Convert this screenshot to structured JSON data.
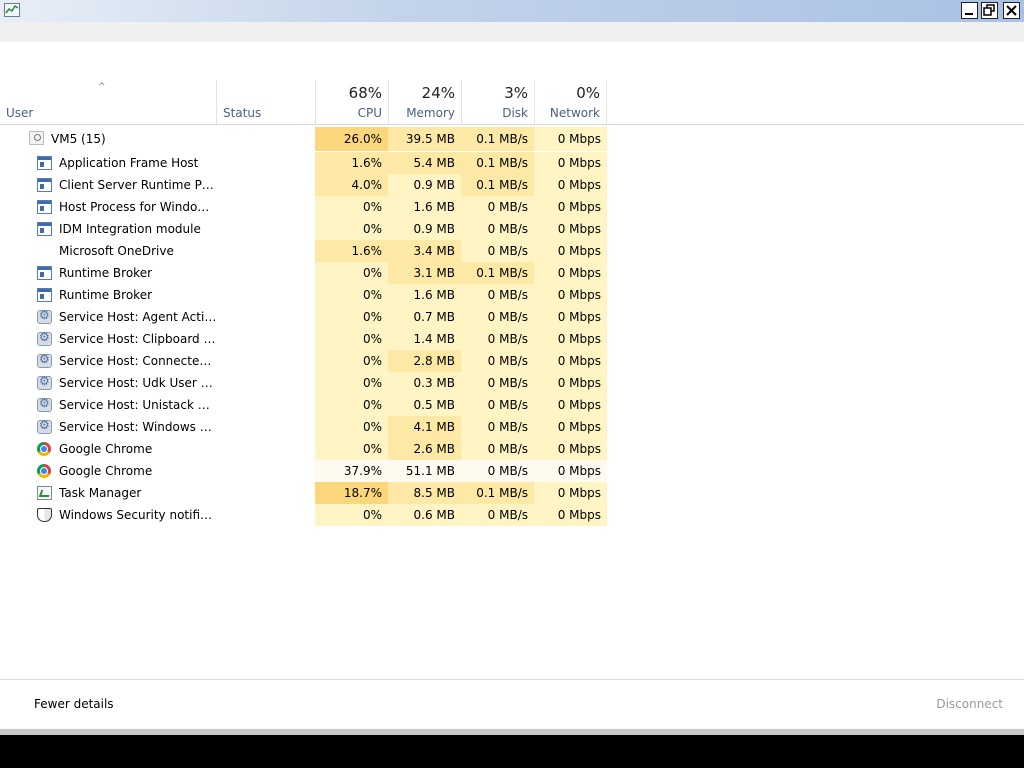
{
  "header": {
    "sort_arrow": "^",
    "user_label": "User",
    "status_label": "Status",
    "cpu_pct": "68%",
    "cpu_label": "CPU",
    "memory_pct": "24%",
    "memory_label": "Memory",
    "disk_pct": "3%",
    "disk_label": "Disk",
    "network_pct": "0%",
    "network_label": "Network"
  },
  "group": {
    "name": "VM5 (15)",
    "cpu": "26.0%",
    "memory": "39.5 MB",
    "disk": "0.1 MB/s",
    "network": "0 Mbps"
  },
  "processes": [
    {
      "name": "Application Frame Host",
      "icon": "window-icon",
      "cpu": "1.6%",
      "memory": "5.4 MB",
      "disk": "0.1 MB/s",
      "network": "0 Mbps"
    },
    {
      "name": "Client Server Runtime Proc...",
      "icon": "window-icon",
      "cpu": "4.0%",
      "memory": "0.9 MB",
      "disk": "0.1 MB/s",
      "network": "0 Mbps"
    },
    {
      "name": "Host Process for Windows ...",
      "icon": "window-icon",
      "cpu": "0%",
      "memory": "1.6 MB",
      "disk": "0 MB/s",
      "network": "0 Mbps"
    },
    {
      "name": "IDM Integration module",
      "icon": "window-icon",
      "cpu": "0%",
      "memory": "0.9 MB",
      "disk": "0 MB/s",
      "network": "0 Mbps"
    },
    {
      "name": "Microsoft OneDrive",
      "icon": "none",
      "cpu": "1.6%",
      "memory": "3.4 MB",
      "disk": "0 MB/s",
      "network": "0 Mbps"
    },
    {
      "name": "Runtime Broker",
      "icon": "window-icon",
      "cpu": "0%",
      "memory": "3.1 MB",
      "disk": "0.1 MB/s",
      "network": "0 Mbps"
    },
    {
      "name": "Runtime Broker",
      "icon": "window-icon",
      "cpu": "0%",
      "memory": "1.6 MB",
      "disk": "0 MB/s",
      "network": "0 Mbps"
    },
    {
      "name": "Service Host: Agent Activa...",
      "icon": "gear-icon",
      "cpu": "0%",
      "memory": "0.7 MB",
      "disk": "0 MB/s",
      "network": "0 Mbps"
    },
    {
      "name": "Service Host: Clipboard Us...",
      "icon": "gear-icon",
      "cpu": "0%",
      "memory": "1.4 MB",
      "disk": "0 MB/s",
      "network": "0 Mbps"
    },
    {
      "name": "Service Host: Connected D...",
      "icon": "gear-icon",
      "cpu": "0%",
      "memory": "2.8 MB",
      "disk": "0 MB/s",
      "network": "0 Mbps"
    },
    {
      "name": "Service Host: Udk User Ser...",
      "icon": "gear-icon",
      "cpu": "0%",
      "memory": "0.3 MB",
      "disk": "0 MB/s",
      "network": "0 Mbps"
    },
    {
      "name": "Service Host: Unistack Serv...",
      "icon": "gear-icon",
      "cpu": "0%",
      "memory": "0.5 MB",
      "disk": "0 MB/s",
      "network": "0 Mbps"
    },
    {
      "name": "Service Host: Windows Pus...",
      "icon": "gear-icon",
      "cpu": "0%",
      "memory": "4.1 MB",
      "disk": "0 MB/s",
      "network": "0 Mbps"
    },
    {
      "name": "Google Chrome",
      "icon": "chrome-icon",
      "cpu": "0%",
      "memory": "2.6 MB",
      "disk": "0 MB/s",
      "network": "0 Mbps"
    },
    {
      "name": "Google Chrome",
      "icon": "chrome-icon",
      "cpu": "37.9%",
      "memory": "51.1 MB",
      "disk": "0 MB/s",
      "network": "0 Mbps"
    },
    {
      "name": "Task Manager",
      "icon": "task-manager-icon",
      "cpu": "18.7%",
      "memory": "8.5 MB",
      "disk": "0.1 MB/s",
      "network": "0 Mbps"
    },
    {
      "name": "Windows Security notificat...",
      "icon": "shield-icon",
      "cpu": "0%",
      "memory": "0.6 MB",
      "disk": "0 MB/s",
      "network": "0 Mbps"
    }
  ],
  "footer": {
    "fewer_details": "Fewer details",
    "disconnect": "Disconnect"
  },
  "colors": {
    "heat_light": "#fff4c4",
    "heat_mid": "#fde9a5",
    "heat_strong": "#fbd67b",
    "heat_selected_row": "#fffaf0"
  }
}
